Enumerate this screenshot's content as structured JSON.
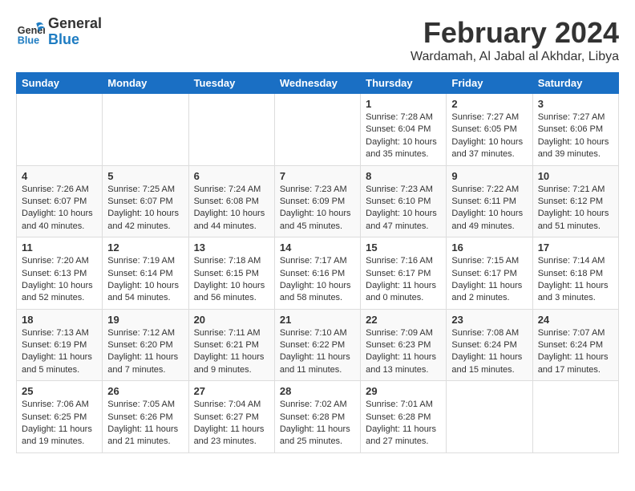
{
  "header": {
    "month_title": "February 2024",
    "location": "Wardamah, Al Jabal al Akhdar, Libya",
    "logo_general": "General",
    "logo_blue": "Blue"
  },
  "weekdays": [
    "Sunday",
    "Monday",
    "Tuesday",
    "Wednesday",
    "Thursday",
    "Friday",
    "Saturday"
  ],
  "weeks": [
    [
      {
        "day": "",
        "info": ""
      },
      {
        "day": "",
        "info": ""
      },
      {
        "day": "",
        "info": ""
      },
      {
        "day": "",
        "info": ""
      },
      {
        "day": "1",
        "info": "Sunrise: 7:28 AM\nSunset: 6:04 PM\nDaylight: 10 hours\nand 35 minutes."
      },
      {
        "day": "2",
        "info": "Sunrise: 7:27 AM\nSunset: 6:05 PM\nDaylight: 10 hours\nand 37 minutes."
      },
      {
        "day": "3",
        "info": "Sunrise: 7:27 AM\nSunset: 6:06 PM\nDaylight: 10 hours\nand 39 minutes."
      }
    ],
    [
      {
        "day": "4",
        "info": "Sunrise: 7:26 AM\nSunset: 6:07 PM\nDaylight: 10 hours\nand 40 minutes."
      },
      {
        "day": "5",
        "info": "Sunrise: 7:25 AM\nSunset: 6:07 PM\nDaylight: 10 hours\nand 42 minutes."
      },
      {
        "day": "6",
        "info": "Sunrise: 7:24 AM\nSunset: 6:08 PM\nDaylight: 10 hours\nand 44 minutes."
      },
      {
        "day": "7",
        "info": "Sunrise: 7:23 AM\nSunset: 6:09 PM\nDaylight: 10 hours\nand 45 minutes."
      },
      {
        "day": "8",
        "info": "Sunrise: 7:23 AM\nSunset: 6:10 PM\nDaylight: 10 hours\nand 47 minutes."
      },
      {
        "day": "9",
        "info": "Sunrise: 7:22 AM\nSunset: 6:11 PM\nDaylight: 10 hours\nand 49 minutes."
      },
      {
        "day": "10",
        "info": "Sunrise: 7:21 AM\nSunset: 6:12 PM\nDaylight: 10 hours\nand 51 minutes."
      }
    ],
    [
      {
        "day": "11",
        "info": "Sunrise: 7:20 AM\nSunset: 6:13 PM\nDaylight: 10 hours\nand 52 minutes."
      },
      {
        "day": "12",
        "info": "Sunrise: 7:19 AM\nSunset: 6:14 PM\nDaylight: 10 hours\nand 54 minutes."
      },
      {
        "day": "13",
        "info": "Sunrise: 7:18 AM\nSunset: 6:15 PM\nDaylight: 10 hours\nand 56 minutes."
      },
      {
        "day": "14",
        "info": "Sunrise: 7:17 AM\nSunset: 6:16 PM\nDaylight: 10 hours\nand 58 minutes."
      },
      {
        "day": "15",
        "info": "Sunrise: 7:16 AM\nSunset: 6:17 PM\nDaylight: 11 hours\nand 0 minutes."
      },
      {
        "day": "16",
        "info": "Sunrise: 7:15 AM\nSunset: 6:17 PM\nDaylight: 11 hours\nand 2 minutes."
      },
      {
        "day": "17",
        "info": "Sunrise: 7:14 AM\nSunset: 6:18 PM\nDaylight: 11 hours\nand 3 minutes."
      }
    ],
    [
      {
        "day": "18",
        "info": "Sunrise: 7:13 AM\nSunset: 6:19 PM\nDaylight: 11 hours\nand 5 minutes."
      },
      {
        "day": "19",
        "info": "Sunrise: 7:12 AM\nSunset: 6:20 PM\nDaylight: 11 hours\nand 7 minutes."
      },
      {
        "day": "20",
        "info": "Sunrise: 7:11 AM\nSunset: 6:21 PM\nDaylight: 11 hours\nand 9 minutes."
      },
      {
        "day": "21",
        "info": "Sunrise: 7:10 AM\nSunset: 6:22 PM\nDaylight: 11 hours\nand 11 minutes."
      },
      {
        "day": "22",
        "info": "Sunrise: 7:09 AM\nSunset: 6:23 PM\nDaylight: 11 hours\nand 13 minutes."
      },
      {
        "day": "23",
        "info": "Sunrise: 7:08 AM\nSunset: 6:24 PM\nDaylight: 11 hours\nand 15 minutes."
      },
      {
        "day": "24",
        "info": "Sunrise: 7:07 AM\nSunset: 6:24 PM\nDaylight: 11 hours\nand 17 minutes."
      }
    ],
    [
      {
        "day": "25",
        "info": "Sunrise: 7:06 AM\nSunset: 6:25 PM\nDaylight: 11 hours\nand 19 minutes."
      },
      {
        "day": "26",
        "info": "Sunrise: 7:05 AM\nSunset: 6:26 PM\nDaylight: 11 hours\nand 21 minutes."
      },
      {
        "day": "27",
        "info": "Sunrise: 7:04 AM\nSunset: 6:27 PM\nDaylight: 11 hours\nand 23 minutes."
      },
      {
        "day": "28",
        "info": "Sunrise: 7:02 AM\nSunset: 6:28 PM\nDaylight: 11 hours\nand 25 minutes."
      },
      {
        "day": "29",
        "info": "Sunrise: 7:01 AM\nSunset: 6:28 PM\nDaylight: 11 hours\nand 27 minutes."
      },
      {
        "day": "",
        "info": ""
      },
      {
        "day": "",
        "info": ""
      }
    ]
  ]
}
